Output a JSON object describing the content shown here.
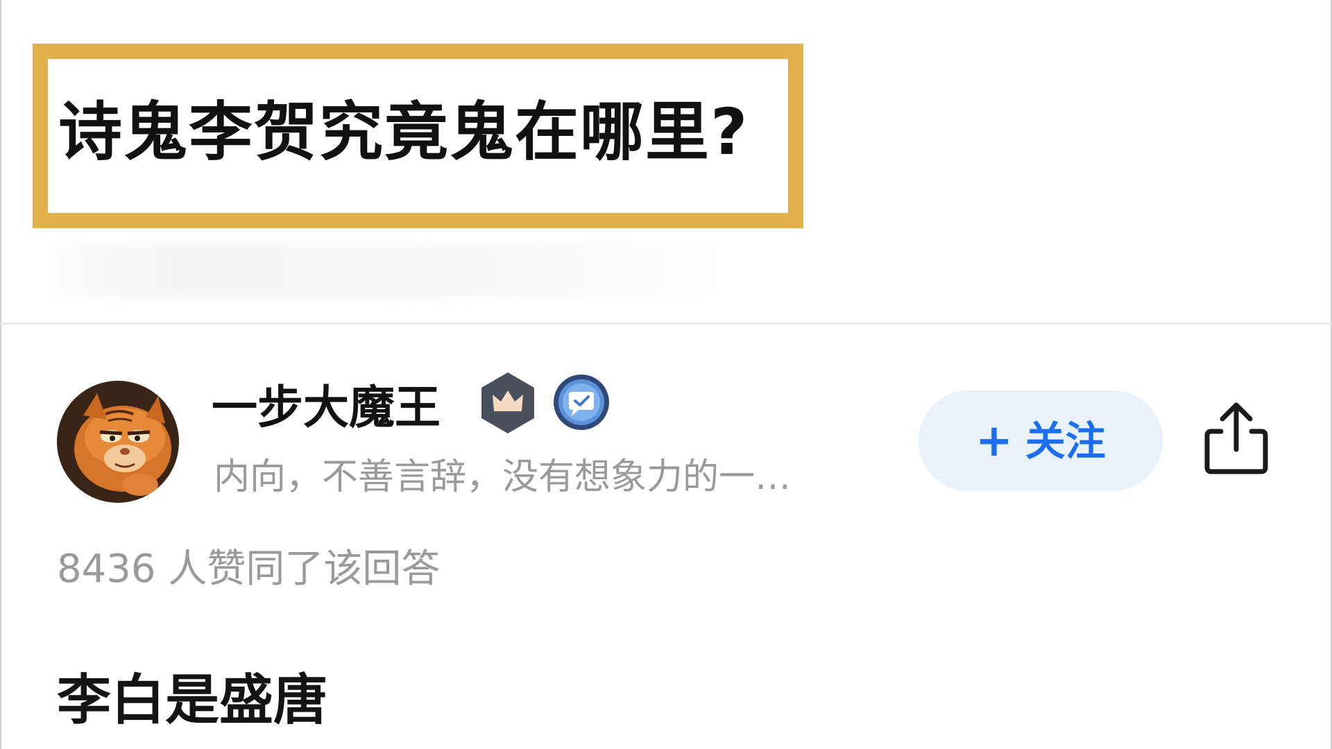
{
  "question": {
    "title": "诗鬼李贺究竟鬼在哪里?"
  },
  "author": {
    "name": "一步大魔王",
    "bio": "内向，不善言辞，没有想象力的一…",
    "avatar_icon": "garfield-cat-avatar",
    "badges": [
      "crown-badge-icon",
      "verified-chat-badge-icon"
    ]
  },
  "actions": {
    "follow_plus": "+",
    "follow_label": "关注",
    "share_icon": "share-icon"
  },
  "stats": {
    "votes_text": "8436 人赞同了该回答"
  },
  "answer": {
    "first_line": "李白是盛唐"
  },
  "colors": {
    "title_border": "#e3b04d",
    "follow_bg": "#e9f1fb",
    "follow_text": "#1b6ef0",
    "muted_text": "#9a9a9a",
    "divider": "#ececec"
  }
}
